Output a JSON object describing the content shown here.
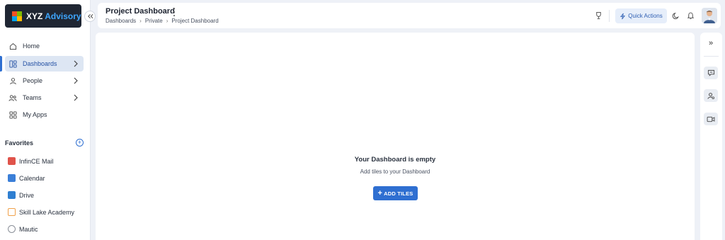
{
  "brand": {
    "name_part1": "XYZ",
    "name_part2": "Advisory"
  },
  "sidebar": {
    "collapse_icon": "double-chevron-left",
    "nav": [
      {
        "label": "Home",
        "icon": "home-icon",
        "active": false,
        "has_children": false
      },
      {
        "label": "Dashboards",
        "icon": "dashboard-icon",
        "active": true,
        "has_children": true
      },
      {
        "label": "People",
        "icon": "person-icon",
        "active": false,
        "has_children": true
      },
      {
        "label": "Teams",
        "icon": "team-icon",
        "active": false,
        "has_children": true
      },
      {
        "label": "My Apps",
        "icon": "apps-grid-icon",
        "active": false,
        "has_children": false
      }
    ],
    "favorites_title": "Favorites",
    "favorites_add": "+",
    "favorites": [
      {
        "label": "InfinCE Mail",
        "icon": "mail-app-icon",
        "color": "#e0534a"
      },
      {
        "label": "Calendar",
        "icon": "calendar-app-icon",
        "color": "#3b7fd8"
      },
      {
        "label": "Drive",
        "icon": "drive-app-icon",
        "color": "#2f7fd1"
      },
      {
        "label": "Skill Lake Academy",
        "icon": "academy-app-icon",
        "color": "#f0a14a"
      },
      {
        "label": "Mautic",
        "icon": "mautic-app-icon",
        "color": "#8a8f98"
      }
    ]
  },
  "header": {
    "title": "Project Dashboard",
    "breadcrumb": [
      "Dashboards",
      "Private",
      "Project Dashboard"
    ],
    "quick_actions_label": "Quick Actions"
  },
  "main": {
    "empty_title": "Your Dashboard is empty",
    "empty_subtitle": "Add tiles to your Dashboard",
    "add_button_plus": "+",
    "add_button_label": "ADD TILES"
  },
  "rail": {
    "expand_icon": "»"
  },
  "colors": {
    "accent": "#2f6fd1",
    "active_bg": "#dde6f3",
    "app_bg": "#eef1f7"
  }
}
